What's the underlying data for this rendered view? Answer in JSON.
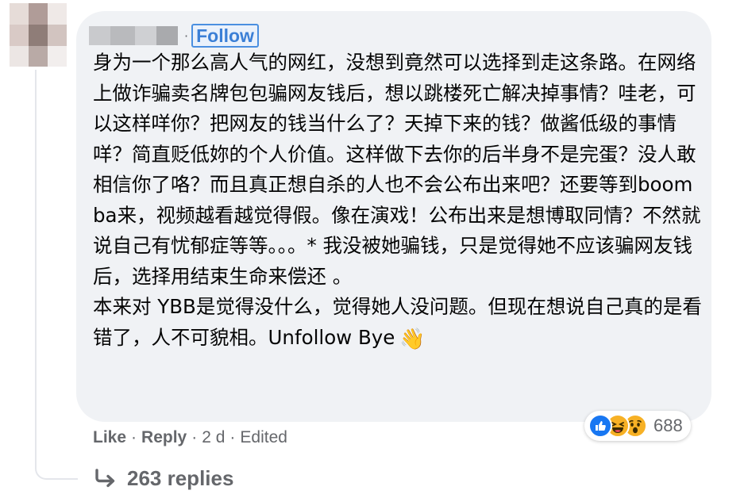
{
  "comment": {
    "follow_label": "Follow",
    "text": "身为一个那么高人气的网红，没想到竟然可以选择到走这条路。在网络上做诈骗卖名牌包包骗网友钱后，想以跳楼死亡解决掉事情？哇老，可以这样咩你？把网友的钱当什么了？天掉下来的钱？做酱低级的事情咩？简直贬低妳的个人价值。这样做下去你的后半身不是完蛋？没人敢相信你了咯？而且真正想自杀的人也不会公布出来吧？还要等到boomba来，视频越看越觉得假。像在演戏！公布出来是想博取同情？不然就说自己有忧郁症等等。。。* 我没被她骗钱，只是觉得她不应该骗网友钱后，选择用结束生命来偿还 。\n本来对 YBB是觉得没什么，觉得她人没问题。但现在想说自己真的是看错了，人不可貌相。Unfollow Bye",
    "emoji": "👋"
  },
  "reactions": {
    "icons": [
      "like-icon",
      "haha-icon",
      "wow-icon"
    ],
    "count": "688"
  },
  "actions": {
    "like_label": "Like",
    "reply_label": "Reply",
    "time": "2 d",
    "edited_label": "Edited",
    "separator": "·"
  },
  "replies": {
    "label": "263 replies"
  },
  "colors": {
    "bubble_bg": "#f0f2f5",
    "link_blue": "#3b7fd6",
    "meta_gray": "#65676b",
    "like_blue": "#1877f2",
    "emoji_yellow": "#f7b125"
  }
}
